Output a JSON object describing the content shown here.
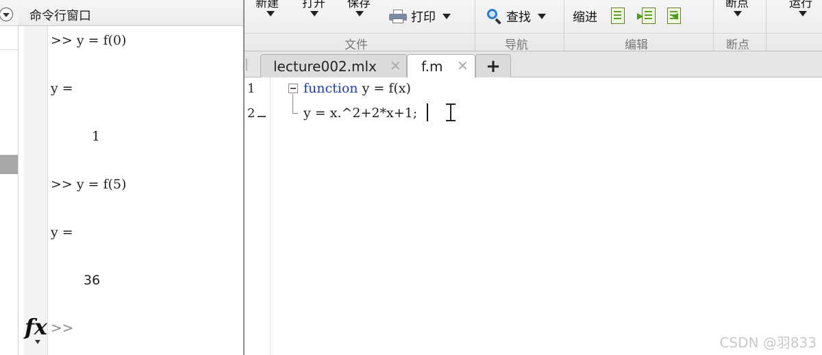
{
  "command_window": {
    "title": "命令行窗口",
    "lines": [
      {
        "text": ">> y = f(0)"
      },
      {
        "text": "y ="
      },
      {
        "text": "1"
      },
      {
        "text": ">> y = f(5)"
      },
      {
        "text": "y ="
      },
      {
        "text": "36"
      }
    ],
    "fx_label": "fx",
    "prompt": ">>"
  },
  "toolstrip": {
    "file": {
      "new_label": "新建",
      "open_label": "打开",
      "save_label": "保存",
      "print_label": "打印",
      "section": "文件"
    },
    "navigate": {
      "find_label": "查找",
      "section": "导航"
    },
    "edit": {
      "indent_label": "缩进",
      "section": "编辑"
    },
    "breakpoints": {
      "label": "断点",
      "section": "断点"
    },
    "run": {
      "label": "运行"
    }
  },
  "tabs": [
    {
      "label": "lecture002.mlx",
      "active": false
    },
    {
      "label": "f.m",
      "active": true
    }
  ],
  "add_tab_label": "+",
  "editor": {
    "lines": [
      {
        "number": "1",
        "keyword": "function",
        "text": " y = f(x)"
      },
      {
        "number": "2",
        "keyword": "",
        "text": "y = x.^2+2*x+1;"
      }
    ]
  },
  "watermark": "CSDN @羽833",
  "colors": {
    "keyword": "#1a3eb5",
    "accent_green": "#4b9a1e"
  }
}
